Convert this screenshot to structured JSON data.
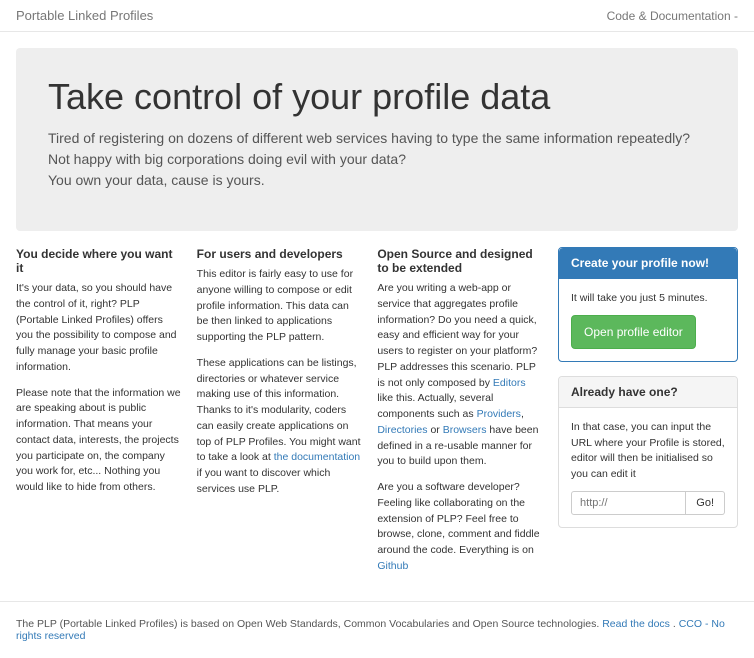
{
  "nav": {
    "brand": "Portable Linked Profiles",
    "doc_link": "Code & Documentation",
    "caret": "-"
  },
  "hero": {
    "title": "Take control of your profile data",
    "line1": "Tired of registering on dozens of different web services having to type the same information repeatedly?",
    "line2": "Not happy with big corporations doing evil with your data?",
    "line3": "You own your data, cause is yours."
  },
  "col1": {
    "heading": "You decide where you want it",
    "p1": "It's your data, so you should have the control of it, right? PLP (Portable Linked Profiles) offers you the possibility to compose and fully manage your basic profile information.",
    "p2": "Please note that the information we are speaking about is public information. That means your contact data, interests, the projects you participate on, the company you work for, etc... Nothing you would like to hide from others."
  },
  "col2": {
    "heading": "For users and developers",
    "p1": "This editor is fairly easy to use for anyone willing to compose or edit profile information. This data can be then linked to applications supporting the PLP pattern.",
    "p2a": "These applications can be listings, directories or whatever service making use of this information. Thanks to it's modularity, coders can easily create applications on top of PLP Profiles. You might want to take a look at ",
    "p2link": "the documentation",
    "p2b": " if you want to discover which services use PLP."
  },
  "col3": {
    "heading": "Open Source and designed to be extended",
    "p1a": "Are you writing a web-app or service that aggregates profile information? Do you need a quick, easy and efficient way for your users to register on your platform? PLP addresses this scenario. PLP is not only composed by ",
    "link_editors": "Editors",
    "p1b": " like this. Actually, several components such as ",
    "link_providers": "Providers",
    "p1c": ", ",
    "link_directories": "Directories",
    "p1d": " or ",
    "link_browsers": "Browsers",
    "p1e": " have been defined in a re-usable manner for you to build upon them.",
    "p2a": "Are you a software developer? Feeling like collaborating on the extension of PLP? Feel free to browse, clone, comment and fiddle around the code. Everything is on ",
    "link_github": "Github"
  },
  "panel_create": {
    "title": "Create your profile now!",
    "body": "It will take you just 5 minutes.",
    "button": "Open profile editor"
  },
  "panel_have": {
    "title": "Already have one?",
    "body": "In that case, you can input the URL where your Profile is stored, editor will then be initialised so you can edit it",
    "placeholder": "http://",
    "go": "Go!"
  },
  "footer": {
    "text": "The PLP (Portable Linked Profiles) is based on Open Web Standards, Common Vocabularies and Open Source technologies. ",
    "link1": "Read the docs",
    "dot": " . ",
    "link2": "CCO - No rights reserved"
  }
}
